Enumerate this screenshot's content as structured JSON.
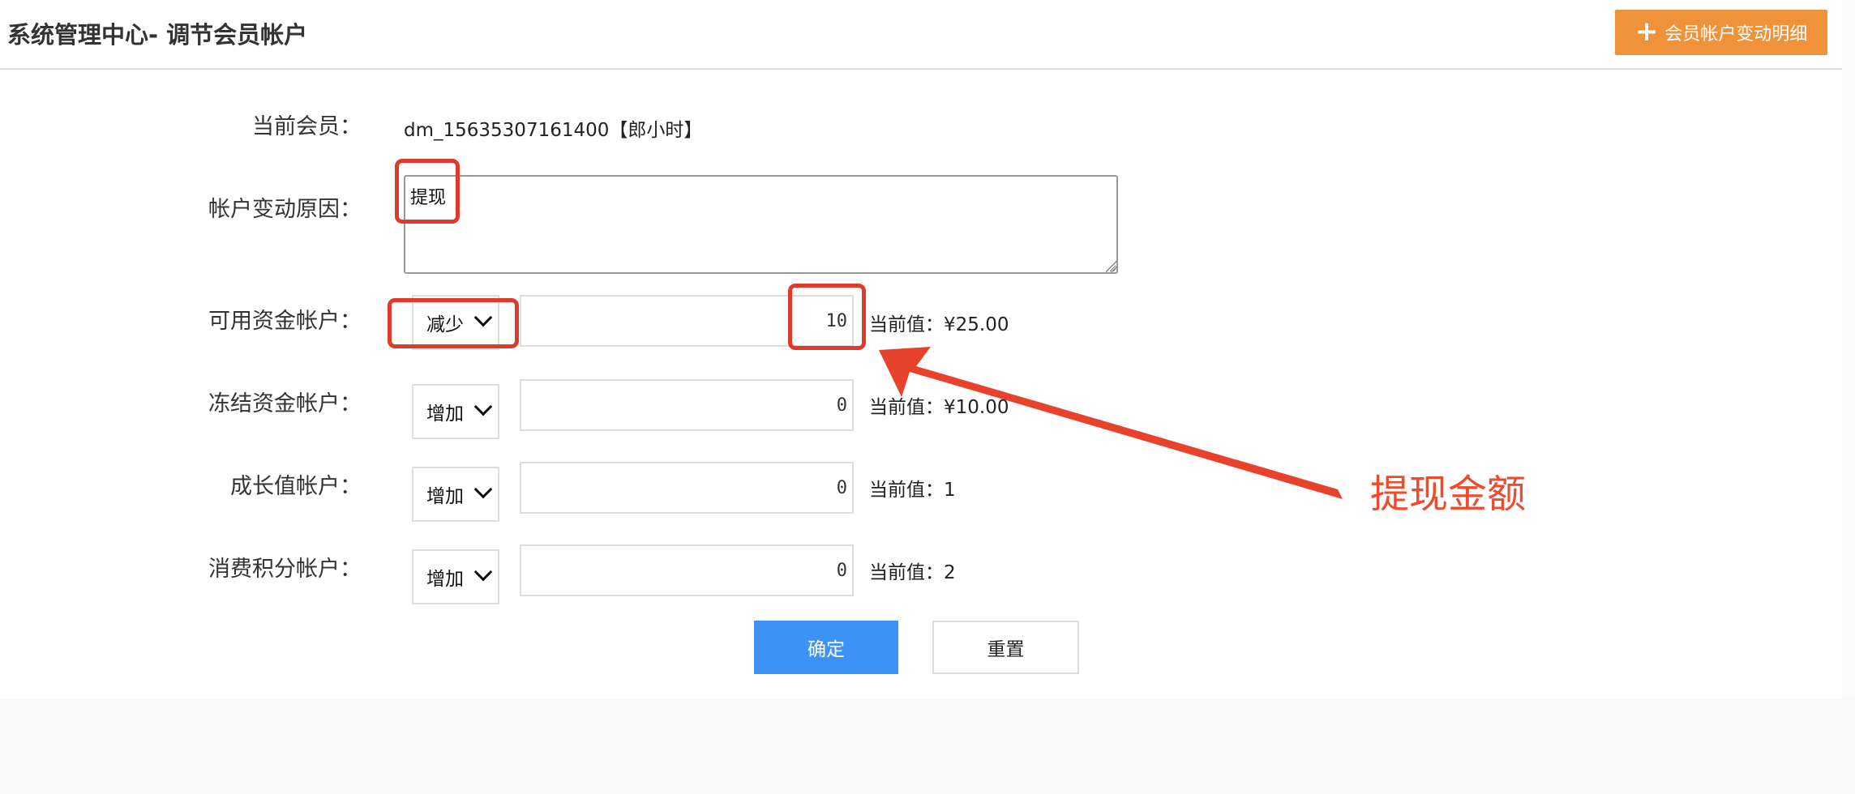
{
  "header": {
    "title": "系统管理中心- 调节会员帐户",
    "detail_button_label": "会员帐户变动明细",
    "detail_button_icon": "plus-icon"
  },
  "form": {
    "member": {
      "label": "当前会员：",
      "value": "dm_15635307161400【郎小时】"
    },
    "reason": {
      "label": "帐户变动原因：",
      "value": "提现"
    },
    "accounts": [
      {
        "label": "可用资金帐户：",
        "operation": "减少",
        "amount": "10",
        "current": "当前值：¥25.00"
      },
      {
        "label": "冻结资金帐户：",
        "operation": "增加",
        "amount": "0",
        "current": "当前值：¥10.00"
      },
      {
        "label": "成长值帐户：",
        "operation": "增加",
        "amount": "0",
        "current": "当前值：1"
      },
      {
        "label": "消费积分帐户：",
        "operation": "增加",
        "amount": "0",
        "current": "当前值：2"
      }
    ],
    "confirm_label": "确定",
    "reset_label": "重置"
  },
  "annotation": {
    "text": "提现金额",
    "color": "#ee4a2c"
  },
  "colors": {
    "accent_orange": "#f0923a",
    "primary_blue": "#3e92f5",
    "highlight_red": "#e03a2a"
  }
}
